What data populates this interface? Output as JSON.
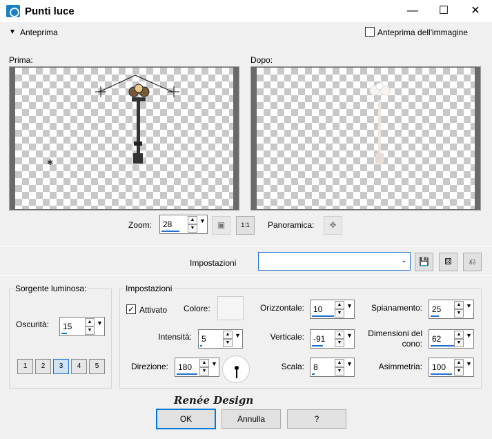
{
  "window": {
    "title": "Punti luce",
    "minimize": "—",
    "maximize": "☐",
    "close": "✕"
  },
  "preview_bar": {
    "toggle_label": "Anteprima",
    "image_preview_label": "Anteprima dell'immagine",
    "image_preview_checked": false
  },
  "before": {
    "label": "Prima:"
  },
  "after": {
    "label": "Dopo:"
  },
  "zoom": {
    "label": "Zoom:",
    "value": "28",
    "pan_label": "Panoramica:"
  },
  "settings_bar": {
    "label": "Impostazioni",
    "value": ""
  },
  "light_source": {
    "group_label": "Sorgente luminosa:",
    "darkness_label": "Oscurità:",
    "darkness_value": "15",
    "lights": [
      "1",
      "2",
      "3",
      "4",
      "5"
    ],
    "selected_light": "3"
  },
  "settings": {
    "group_label": "Impostazioni",
    "enabled_label": "Attivato",
    "enabled": true,
    "color_label": "Colore:",
    "color_value": "#f5f5f5",
    "intensity_label": "Intensità:",
    "intensity_value": "5",
    "direction_label": "Direzione:",
    "direction_value": "180",
    "horizontal_label": "Orizzontale:",
    "horizontal_value": "10",
    "vertical_label": "Verticale:",
    "vertical_value": "-91",
    "scale_label": "Scala:",
    "scale_value": "8",
    "smoothing_label": "Spianamento:",
    "smoothing_value": "25",
    "cone_label": "Dimensioni del cono:",
    "cone_value": "62",
    "asymmetry_label": "Asimmetria:",
    "asymmetry_value": "100"
  },
  "buttons": {
    "ok": "OK",
    "cancel": "Annulla",
    "help": "?"
  },
  "watermark": "Renée Design"
}
